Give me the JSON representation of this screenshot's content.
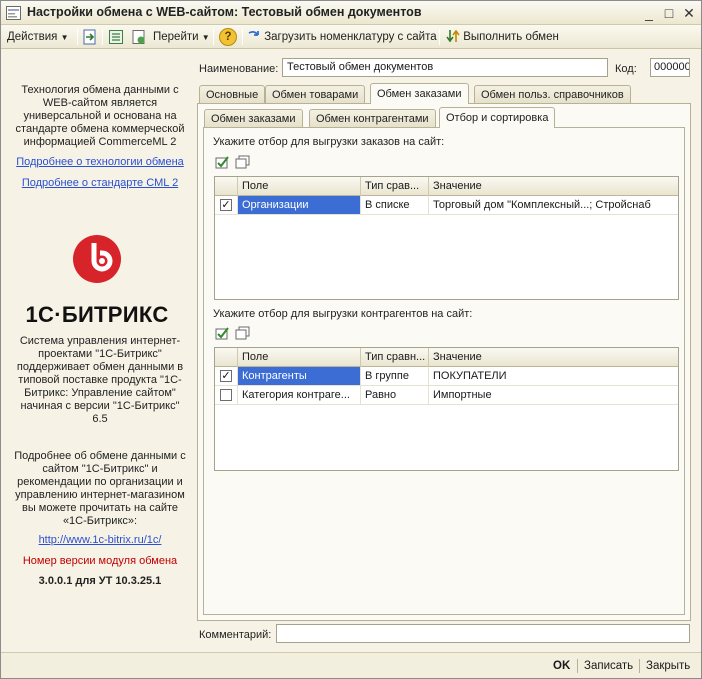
{
  "window": {
    "title": "Настройки обмена с WEB-сайтом: Тестовый обмен документов",
    "controls": {
      "minimize": "_",
      "maximize": "□",
      "close": "✕"
    }
  },
  "toolbar": {
    "actions": "Действия",
    "goto": "Перейти",
    "help": "?",
    "load_nomenclature": "Загрузить номенклатуру с сайта",
    "run_exchange": "Выполнить обмен"
  },
  "left_panel": {
    "intro": "Технология обмена данными с WEB-сайтом является универсальной и основана на стандарте обмена коммерческой информацией CommerceML 2",
    "link_technology": "Подробнее о технологии обмена",
    "link_standard": "Подробнее о стандарте CML 2",
    "brand": "1С·БИТРИКС",
    "brand_description": "Система управления интернет-проектами \"1С-Битрикс\" поддерживает обмен данными в типовой поставке продукта \"1С-Битрикс: Управление сайтом\" начиная с версии \"1С-Битрикс\" 6.5",
    "more_info": "Подробнее об обмене данными с сайтом \"1С-Битрикс\" и рекомендации по организации и управлению интернет-магазином вы можете прочитать на сайте «1С-Битрикс»:",
    "site_link": "http://www.1c-bitrix.ru/1c/",
    "version_label": "Номер версии модуля обмена",
    "version_value": "3.0.0.1 для УТ 10.3.25.1"
  },
  "form": {
    "name_label": "Наименование:",
    "name_value": "Тестовый обмен документов",
    "code_label": "Код:",
    "code_value": "000000",
    "comment_label": "Комментарий:",
    "comment_value": ""
  },
  "tabs": [
    {
      "label": "Основные",
      "active": false
    },
    {
      "label": "Обмен товарами",
      "active": false
    },
    {
      "label": "Обмен заказами",
      "active": true
    },
    {
      "label": "Обмен польз. справочников",
      "active": false
    }
  ],
  "subtabs": [
    {
      "label": "Обмен заказами",
      "active": false
    },
    {
      "label": "Обмен контрагентами",
      "active": false
    },
    {
      "label": "Отбор и сортировка",
      "active": true
    }
  ],
  "orders_filter": {
    "caption": "Укажите отбор для выгрузки заказов на сайт:",
    "columns": [
      "Поле",
      "Тип срав...",
      "Значение"
    ],
    "rows": [
      {
        "checked": true,
        "field": "Организации",
        "compare": "В списке",
        "value": "Торговый дом \"Комплексный...; Стройснаб"
      }
    ]
  },
  "contractors_filter": {
    "caption": "Укажите отбор для выгрузки контрагентов на сайт:",
    "columns": [
      "Поле",
      "Тип сравн...",
      "Значение"
    ],
    "rows": [
      {
        "checked": true,
        "field": "Контрагенты",
        "compare": "В группе",
        "value": "ПОКУПАТЕЛИ"
      },
      {
        "checked": false,
        "field": "Категория контраге...",
        "compare": "Равно",
        "value": "Импортные"
      }
    ]
  },
  "footer": {
    "ok": "OK",
    "save": "Записать",
    "close": "Закрыть"
  },
  "colors": {
    "selection": "#3c6dd4",
    "link": "#2a4fd0",
    "version_label": "#c00000",
    "bitrix_red": "#d7232a"
  }
}
